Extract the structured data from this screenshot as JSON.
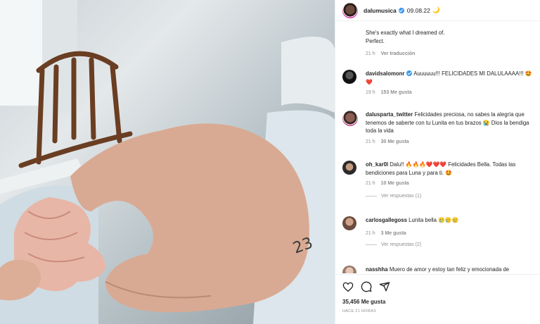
{
  "post": {
    "username": "dalumusica",
    "date": "09.08.22",
    "moon": "🌙",
    "caption_line1": "She's exactly what I dreamed of.",
    "caption_line2": "Perfect.",
    "caption_time": "21 h",
    "see_translation": "Ver traducción"
  },
  "comments": [
    {
      "username": "davidsalomonr",
      "text": "Auuuuuu!!! FELICIDADES MI DALULAAAA!!! 🤩❤️",
      "time": "19 h",
      "likes": "153 Me gusta"
    },
    {
      "username": "dalusparta_twitter",
      "text": "Felicidades preciosa, no sabes la alegría que tenemos de saberte con tu Lunita en tus brazos 😭 Dios la bendiga toda la vida",
      "time": "21 h",
      "likes": "30 Me gusta"
    },
    {
      "username": "oh_kar0l",
      "text": "Dalu!! 🔥🔥🔥❤️❤️❤️ Felicidades Bella. Todas las bendiciones para Luna y para ti. 🤩",
      "time": "21 h",
      "likes": "10 Me gusta",
      "replies": "Ver respuestas (1)"
    },
    {
      "username": "carlosgallegoss",
      "text": "Lunita bella 🥲🥲🥲",
      "time": "21 h",
      "likes": "3 Me gusta",
      "replies": "Ver respuestas (2)"
    },
    {
      "username": "nasshha",
      "text": "Muero de amor y estoy tan feliz y emocionada de"
    }
  ],
  "footer": {
    "likes": "35,456 Me gusta",
    "ago": "HACE 21 HORAS"
  },
  "icons": [
    "heart-icon",
    "comment-icon",
    "share-icon"
  ]
}
